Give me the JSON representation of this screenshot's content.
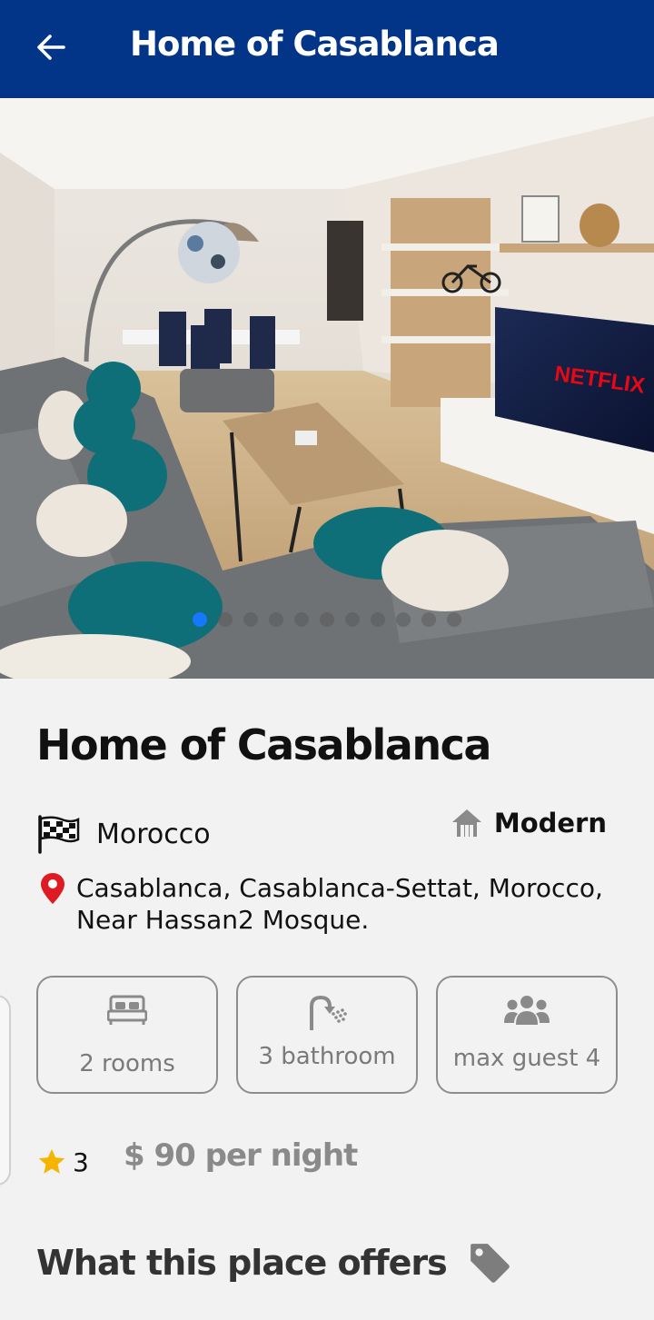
{
  "appbar": {
    "title": "Home of Casablanca"
  },
  "listing": {
    "title": "Home of Casablanca",
    "country": "Morocco",
    "type": "Modern",
    "address": "Casablanca, Casablanca-Settat, Morocco, Near Hassan2 Mosque.",
    "features": {
      "rooms": "2 rooms",
      "bathroom": "3 bathroom",
      "guests": "max guest 4"
    },
    "rating": "3",
    "price": "$ 90 per night",
    "offers_heading": "What this place offers",
    "hero_tv_text": "NETFLIX"
  },
  "carousel": {
    "total": 11,
    "active_index": 0
  },
  "colors": {
    "appbar": "#023587",
    "active_dot": "#1677ff",
    "location_pin": "#e01a22",
    "star": "#f5b400"
  },
  "icons": [
    "back-arrow-icon",
    "flag-icon",
    "house-icon",
    "location-pin-icon",
    "bed-icon",
    "shower-icon",
    "group-icon",
    "star-icon",
    "tag-icon"
  ]
}
